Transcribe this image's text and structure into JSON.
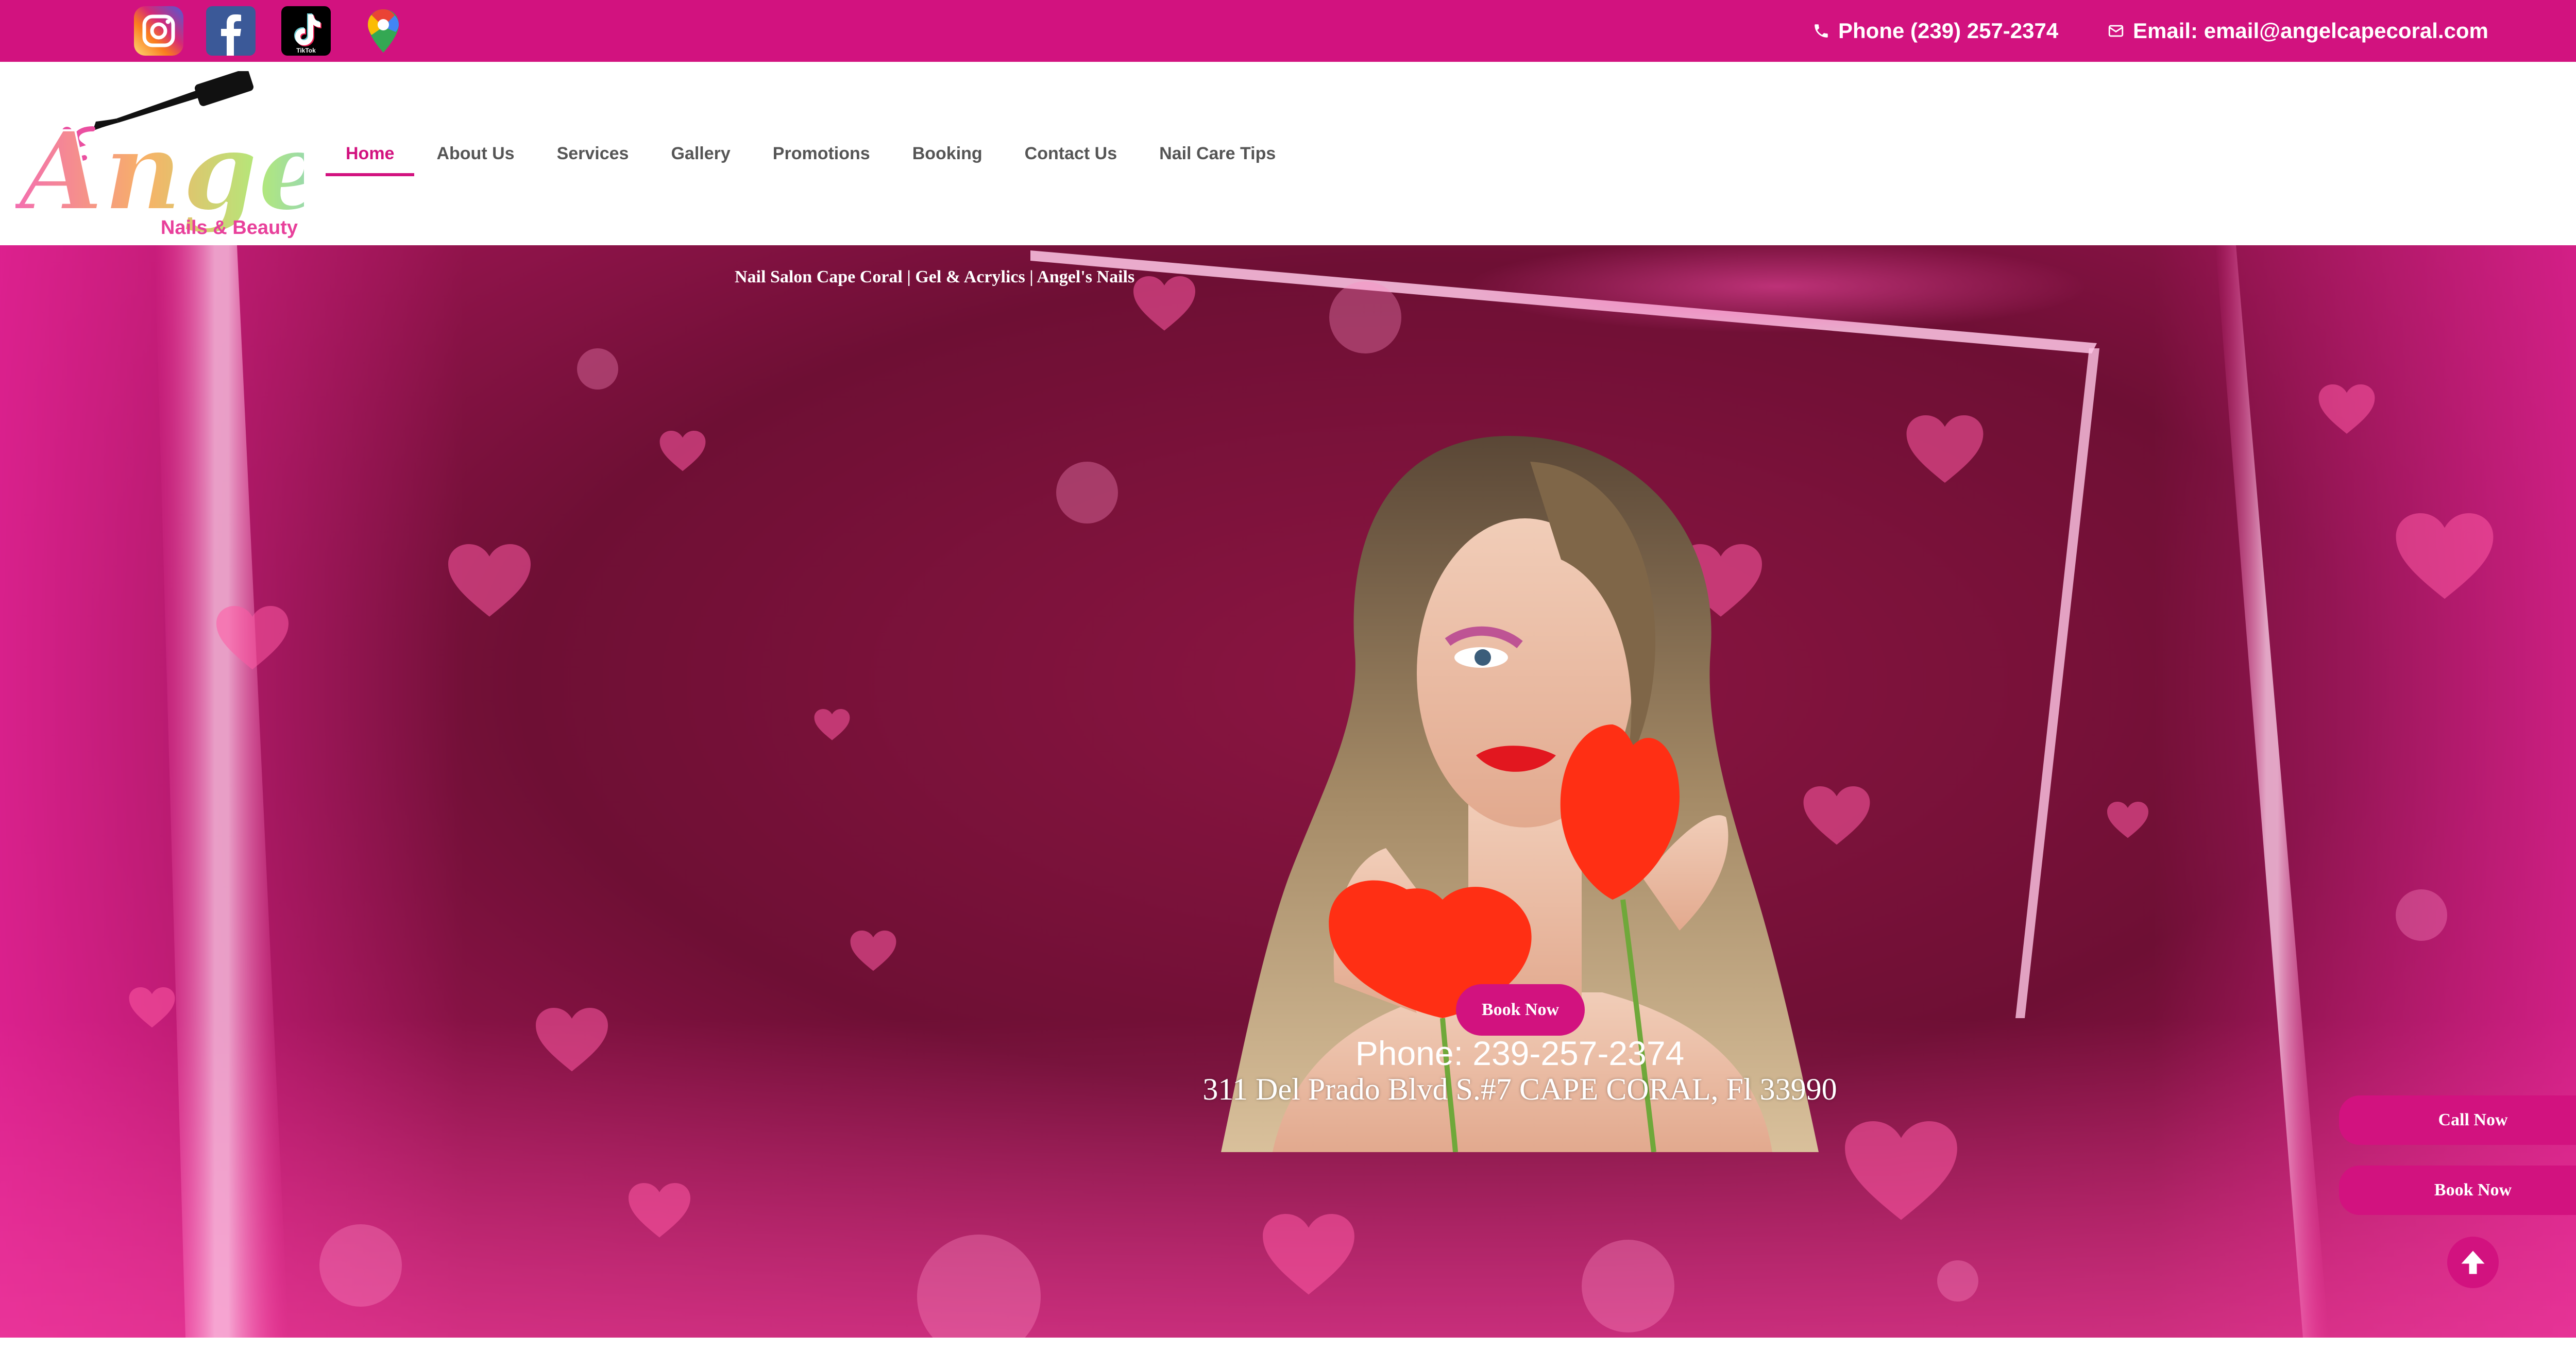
{
  "colors": {
    "brand": "#d2127f",
    "nav_text": "#555555",
    "white": "#ffffff"
  },
  "topbar": {
    "social_icons": [
      "instagram-icon",
      "facebook-icon",
      "tiktok-icon",
      "google-maps-icon"
    ],
    "tiktok_caption": "TikTok",
    "phone": "Phone (239) 257-2374",
    "email": "Email: email@angelcapecoral.com"
  },
  "logo": {
    "title": "Angel's",
    "subtitle": "Nails & Beauty"
  },
  "nav": {
    "items": [
      "Home",
      "About Us",
      "Services",
      "Gallery",
      "Promotions",
      "Booking",
      "Contact Us",
      "Nail Care Tips"
    ],
    "active": "Home"
  },
  "hero": {
    "heading": "Nail Salon Cape Coral | Gel & Acrylics | Angel's Nails",
    "book_label": "Book Now",
    "phone": "Phone: 239-257-2374",
    "address": "311 Del Prado Blvd S.#7 CAPE CORAL, Fl 33990"
  },
  "floating": {
    "call_label": "Call Now",
    "book_label": "Book Now"
  }
}
